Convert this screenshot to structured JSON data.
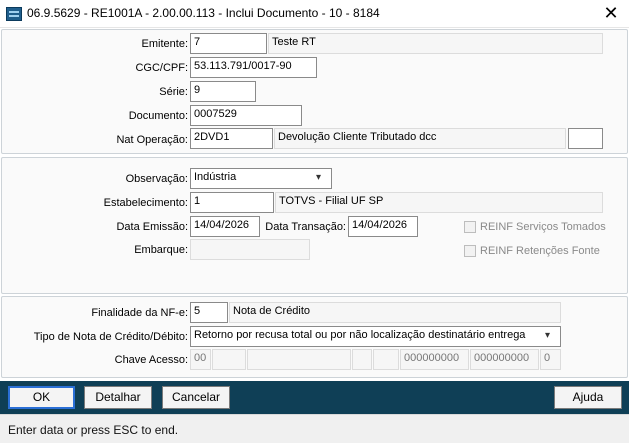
{
  "window": {
    "title": "06.9.5629 - RE1001A - 2.00.00.113 - Inclui Documento - 10 - 8184",
    "close_icon": "close-icon",
    "app_icon": "app-icon"
  },
  "section1": {
    "emitente": {
      "label": "Emitente:",
      "value": "7",
      "desc": "Teste RT"
    },
    "cgc_cpf": {
      "label": "CGC/CPF:",
      "value": "53.113.791/0017-90"
    },
    "serie": {
      "label": "Série:",
      "value": "9"
    },
    "documento": {
      "label": "Documento:",
      "value": "0007529"
    },
    "nat_operacao": {
      "label": "Nat Operação:",
      "value": "2DVD1",
      "desc": "Devolução Cliente Tributado dcc",
      "extra": ""
    }
  },
  "section2": {
    "observacao": {
      "label": "Observação:",
      "value": "Indústria"
    },
    "estabelecimento": {
      "label": "Estabelecimento:",
      "value": "1",
      "desc": "TOTVS - Filial UF SP"
    },
    "data_emissao": {
      "label": "Data Emissão:",
      "value": "14/04/2026"
    },
    "data_transacao": {
      "label": "Data Transação:",
      "value": "14/04/2026"
    },
    "embarque": {
      "label": "Embarque:",
      "value": ""
    },
    "reinf_servicos": {
      "label": "REINF Serviços Tomados",
      "checked": false
    },
    "reinf_retencoes": {
      "label": "REINF Retenções Fonte",
      "checked": false
    }
  },
  "section3": {
    "finalidade": {
      "label": "Finalidade da NF-e:",
      "value": "5",
      "desc": "Nota de Crédito"
    },
    "tipo_nota": {
      "label": "Tipo de Nota de Crédito/Débito:",
      "value": "Retorno por recusa total ou por não localização destinatário entrega"
    },
    "chave_acesso": {
      "label": "Chave Acesso:",
      "parts": [
        "00",
        "",
        "",
        "",
        "",
        "000000000",
        "000000000",
        "0"
      ]
    }
  },
  "buttons": {
    "ok": "OK",
    "detalhar": "Detalhar",
    "cancelar": "Cancelar",
    "ajuda": "Ajuda"
  },
  "status": {
    "text": "Enter data or press ESC to end."
  },
  "colors": {
    "action_bar": "#0f3f56",
    "focus_border": "#2a6fd6",
    "panel_bg": "#fafafa"
  }
}
